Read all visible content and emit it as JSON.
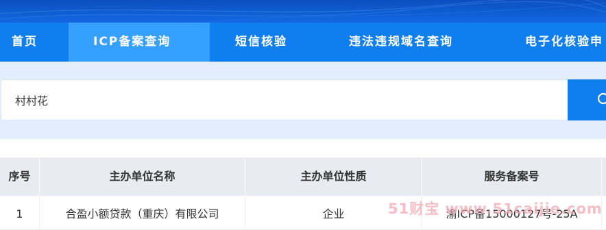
{
  "nav": {
    "items": [
      {
        "label": "首页"
      },
      {
        "label": "ICP备案查询"
      },
      {
        "label": "短信核验"
      },
      {
        "label": "违法违规域名查询"
      },
      {
        "label": "电子化核验申"
      }
    ],
    "active_index": 1
  },
  "search": {
    "value": "村村花",
    "button_icon": "search-icon"
  },
  "table": {
    "headers": [
      "序号",
      "主办单位名称",
      "主办单位性质",
      "服务备案号"
    ],
    "rows": [
      {
        "index": "1",
        "name": "合盈小额贷款（重庆）有限公司",
        "type": "企业",
        "record_no": "渝ICP备15000127号-25A"
      }
    ]
  },
  "watermark": {
    "text": "51财宝 www.51caijie.com"
  },
  "colors": {
    "banner": "#0b4fc0",
    "nav": "#0f7ff0",
    "nav_active": "#35a0ff",
    "search_band": "#e2eefc",
    "table_header": "#e8ebf0"
  }
}
